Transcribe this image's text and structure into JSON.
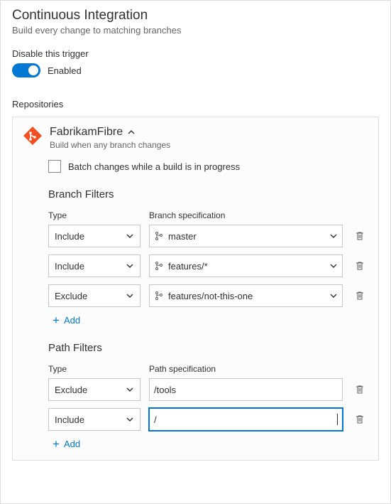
{
  "title": "Continuous Integration",
  "subtitle": "Build every change to matching branches",
  "disable_label": "Disable this trigger",
  "toggle_state": "Enabled",
  "repos_label": "Repositories",
  "repo": {
    "name": "FabrikamFibre",
    "sub": "Build when any branch changes",
    "batch_label": "Batch changes while a build is in progress"
  },
  "branch_filters": {
    "title": "Branch Filters",
    "hdr_type": "Type",
    "hdr_spec": "Branch specification",
    "rows": [
      {
        "type": "Include",
        "spec": "master"
      },
      {
        "type": "Include",
        "spec": "features/*"
      },
      {
        "type": "Exclude",
        "spec": "features/not-this-one"
      }
    ],
    "add": "Add"
  },
  "path_filters": {
    "title": "Path Filters",
    "hdr_type": "Type",
    "hdr_spec": "Path specification",
    "rows": [
      {
        "type": "Exclude",
        "spec": "/tools"
      },
      {
        "type": "Include",
        "spec": "/"
      }
    ],
    "add": "Add"
  }
}
